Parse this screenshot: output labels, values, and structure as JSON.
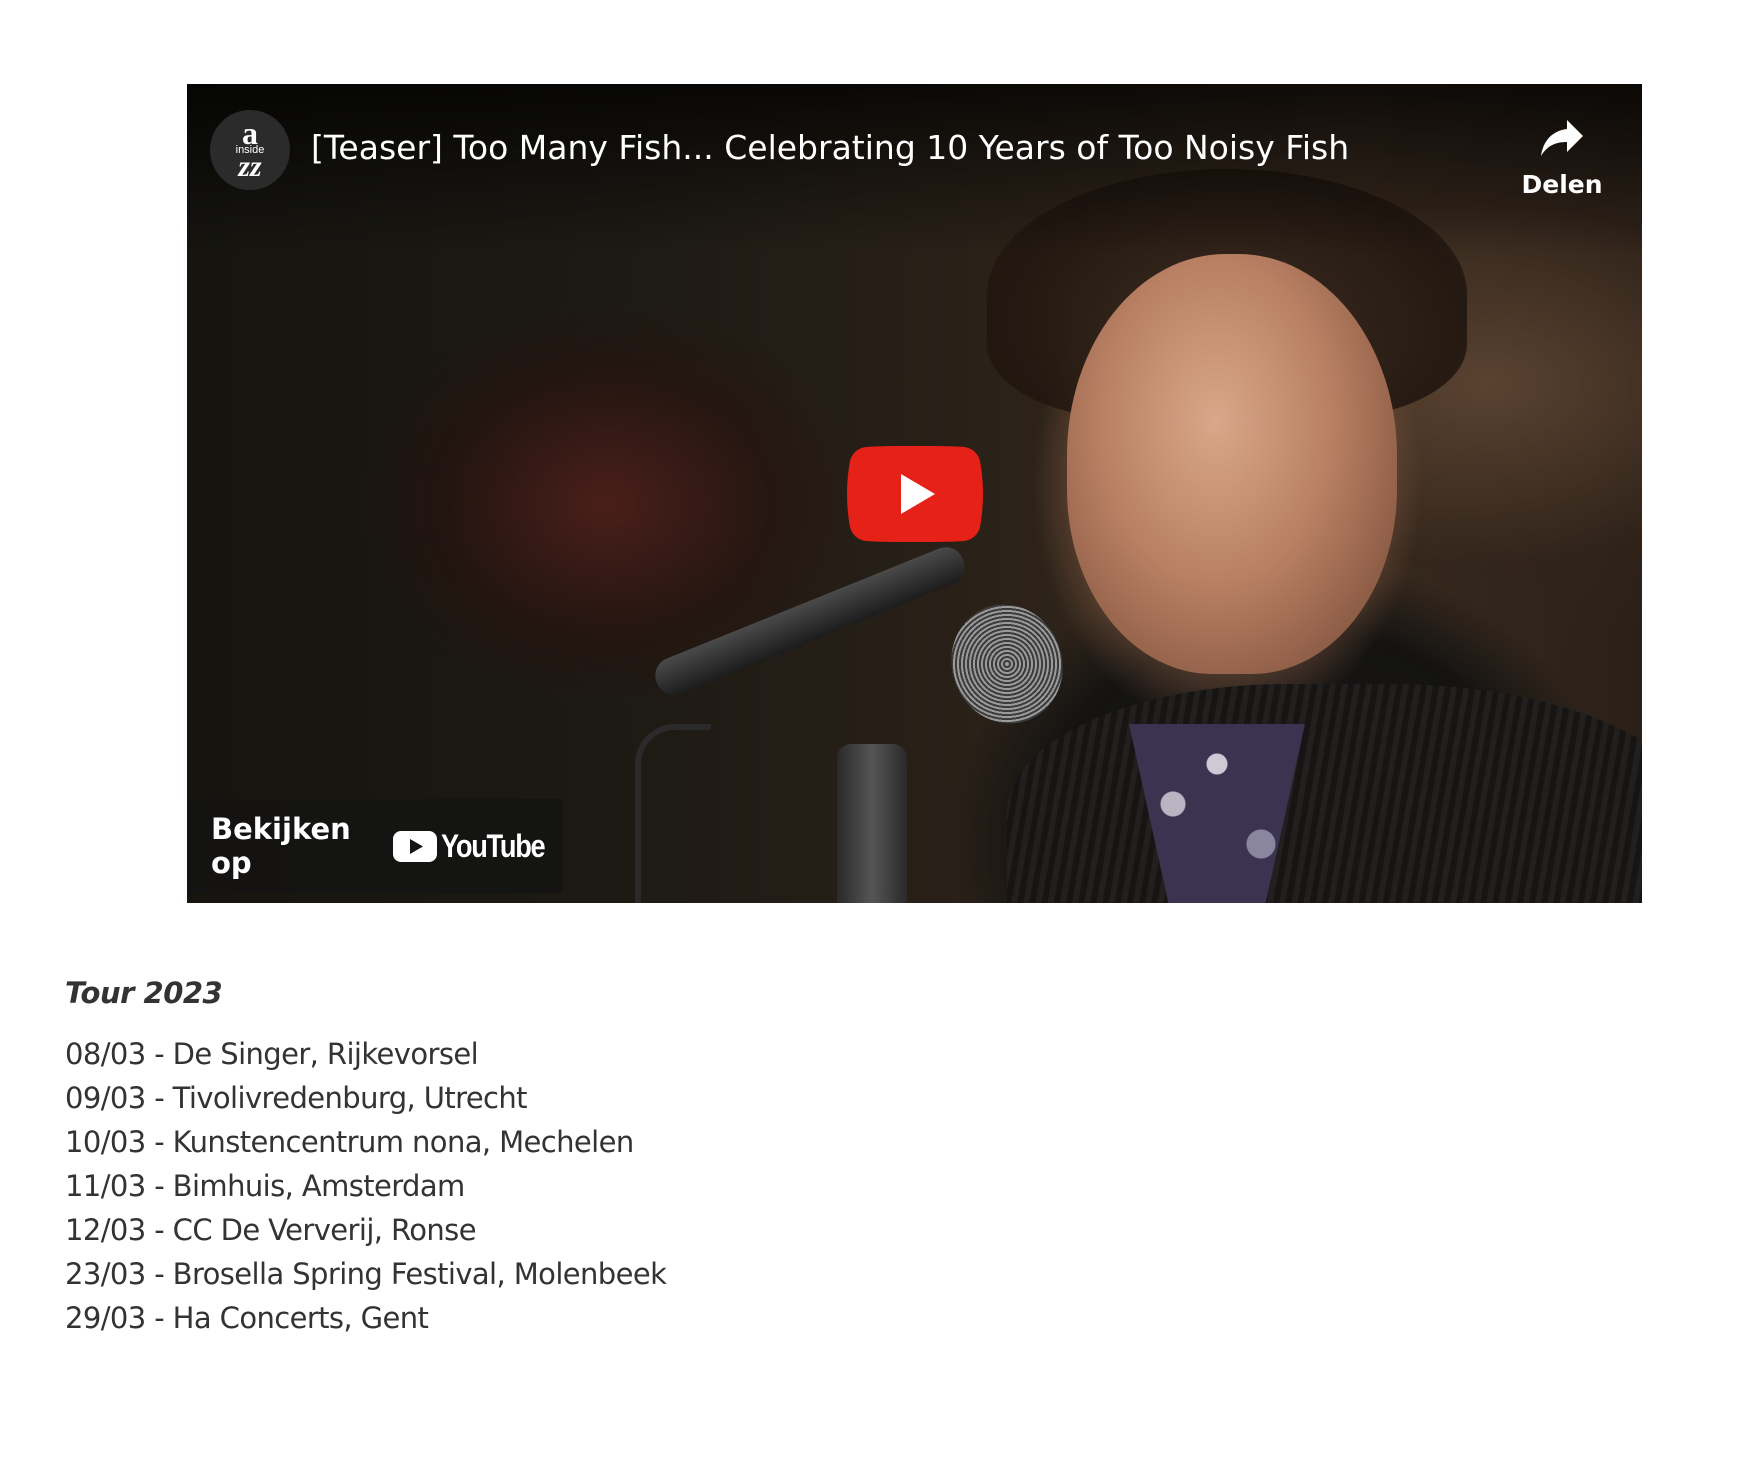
{
  "video": {
    "title": "[Teaser] Too Many Fish... Celebrating 10 Years of Too Noisy Fish",
    "channel_avatar": {
      "line1": "a",
      "line2": "inside",
      "line3": "zz"
    },
    "share_label": "Delen",
    "watch_on_label": "Bekijken op",
    "youtube_wordmark": "YouTube",
    "icons": [
      "share-arrow-icon",
      "play-icon",
      "youtube-logo-icon"
    ],
    "colors": {
      "play_red": "#e62117",
      "overlay": "#141414"
    }
  },
  "tour": {
    "heading": "Tour 2023",
    "dates": [
      "08/03 - De Singer, Rijkevorsel",
      "09/03 - Tivolivredenburg, Utrecht",
      "10/03 - Kunstencentrum nona, Mechelen",
      "11/03 - Bimhuis, Amsterdam",
      "12/03 - CC De Ververij, Ronse",
      "23/03 - Brosella Spring Festival, Molenbeek",
      "29/03 - Ha Concerts, Gent"
    ]
  }
}
